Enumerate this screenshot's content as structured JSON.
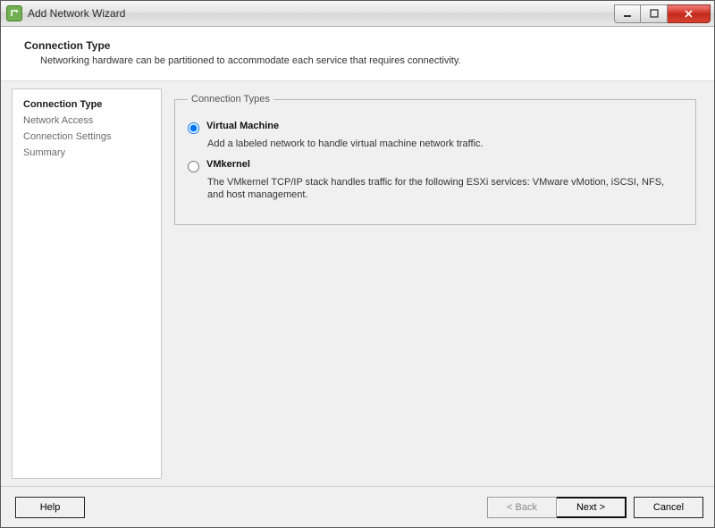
{
  "window": {
    "title": "Add Network Wizard"
  },
  "header": {
    "title": "Connection Type",
    "description": "Networking hardware can be partitioned to accommodate each service that requires connectivity."
  },
  "sidebar": {
    "steps": [
      "Connection Type",
      "Network Access",
      "Connection Settings",
      "Summary"
    ]
  },
  "group": {
    "legend": "Connection Types",
    "options": [
      {
        "label": "Virtual Machine",
        "description": "Add a labeled network to handle virtual machine network traffic.",
        "selected": true
      },
      {
        "label": "VMkernel",
        "description": "The VMkernel TCP/IP stack handles traffic for the following ESXi services: VMware vMotion, iSCSI, NFS, and host management.",
        "selected": false
      }
    ]
  },
  "footer": {
    "help": "Help",
    "back": "< Back",
    "next": "Next >",
    "cancel": "Cancel"
  }
}
